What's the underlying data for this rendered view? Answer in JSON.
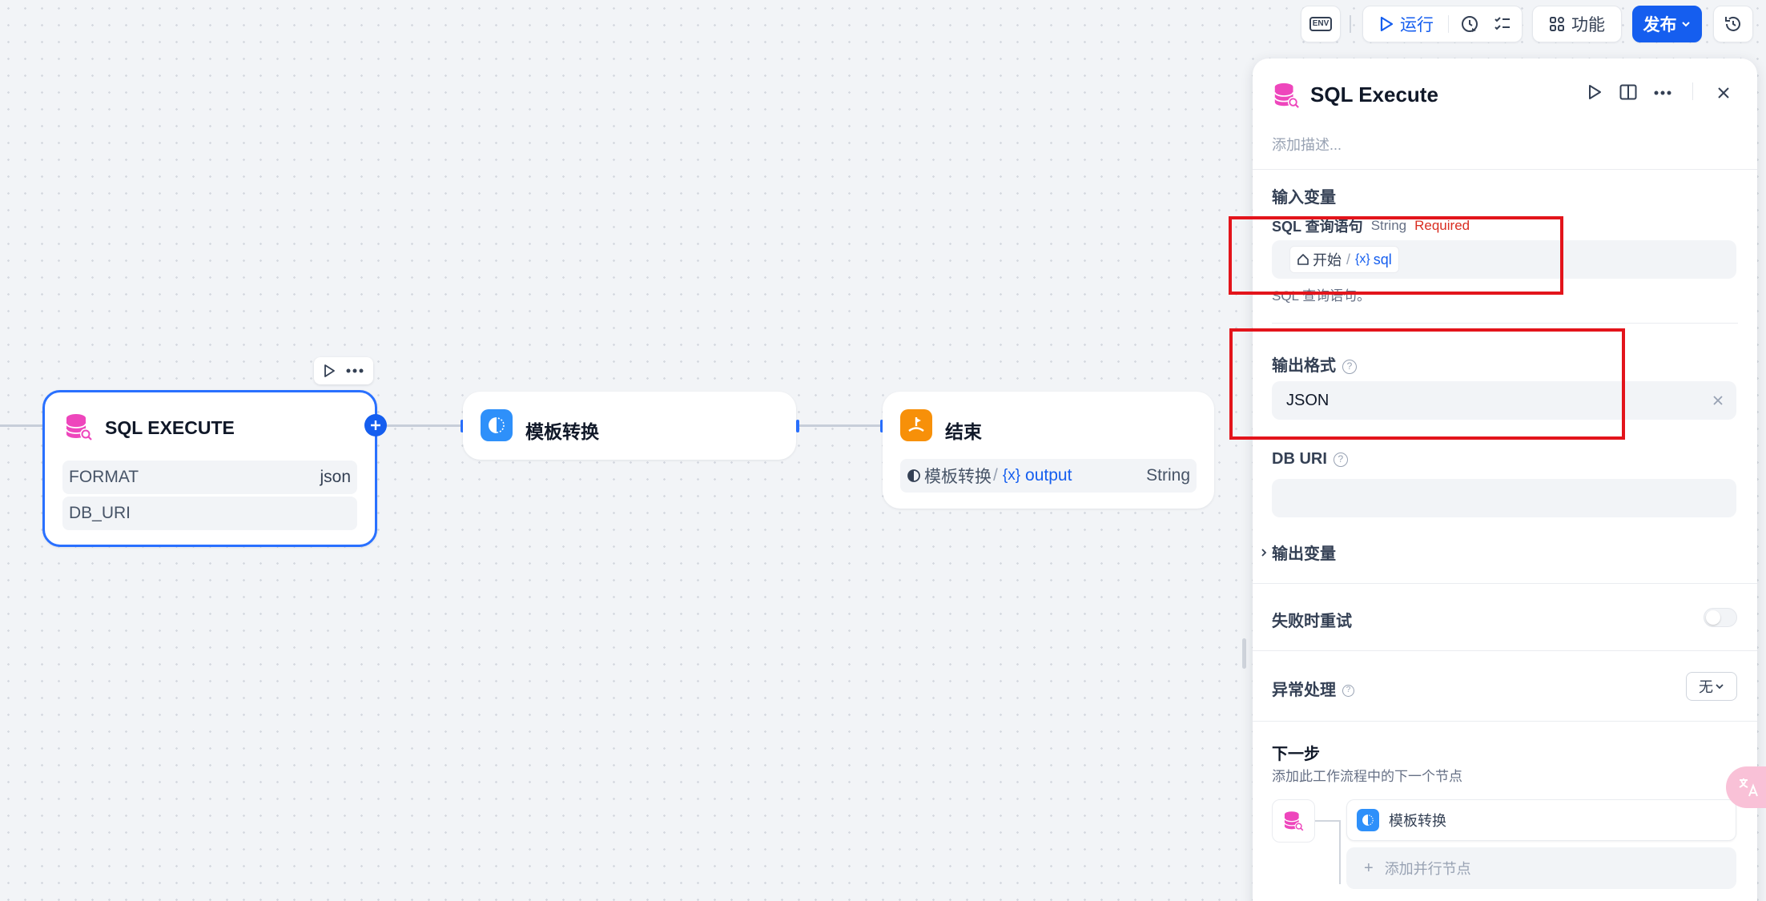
{
  "toolbar": {
    "env_label": "ENV",
    "run_label": "运行",
    "features_label": "功能",
    "publish_label": "发布"
  },
  "canvas": {
    "sql_node": {
      "title": "SQL EXECUTE",
      "rows": [
        {
          "key": "FORMAT",
          "value": "json"
        },
        {
          "key": "DB_URI",
          "value": ""
        }
      ]
    },
    "template_node": {
      "title": "模板转换"
    },
    "end_node": {
      "title": "结束",
      "var_source": "模板转换",
      "var_sep": "/",
      "var_prefix": "{x}",
      "var_name": "output",
      "var_type": "String"
    }
  },
  "panel": {
    "title": "SQL Execute",
    "description_placeholder": "添加描述...",
    "input_vars_label": "输入变量",
    "sql_param": {
      "name": "SQL 查询语句",
      "type": "String",
      "required": "Required",
      "chip_source": "开始",
      "chip_sep": "/",
      "chip_prefix": "{x}",
      "chip_var": "sql",
      "hint": "SQL 查询语句。"
    },
    "output_format_label": "输出格式",
    "output_format_value": "JSON",
    "db_uri_label": "DB URI",
    "output_vars_label": "输出变量",
    "retry_label": "失败时重试",
    "error_label": "异常处理",
    "error_value": "无",
    "next_step_label": "下一步",
    "next_step_desc": "添加此工作流程中的下一个节点",
    "next_node_label": "模板转换",
    "add_parallel_label": "添加并行节点"
  },
  "colors": {
    "accent": "#155eef",
    "sql_icon": "#ee46bc",
    "template_icon": "#2e90fa",
    "end_icon": "#f79009",
    "required": "#d92d20",
    "highlight_box": "#e3141b"
  }
}
